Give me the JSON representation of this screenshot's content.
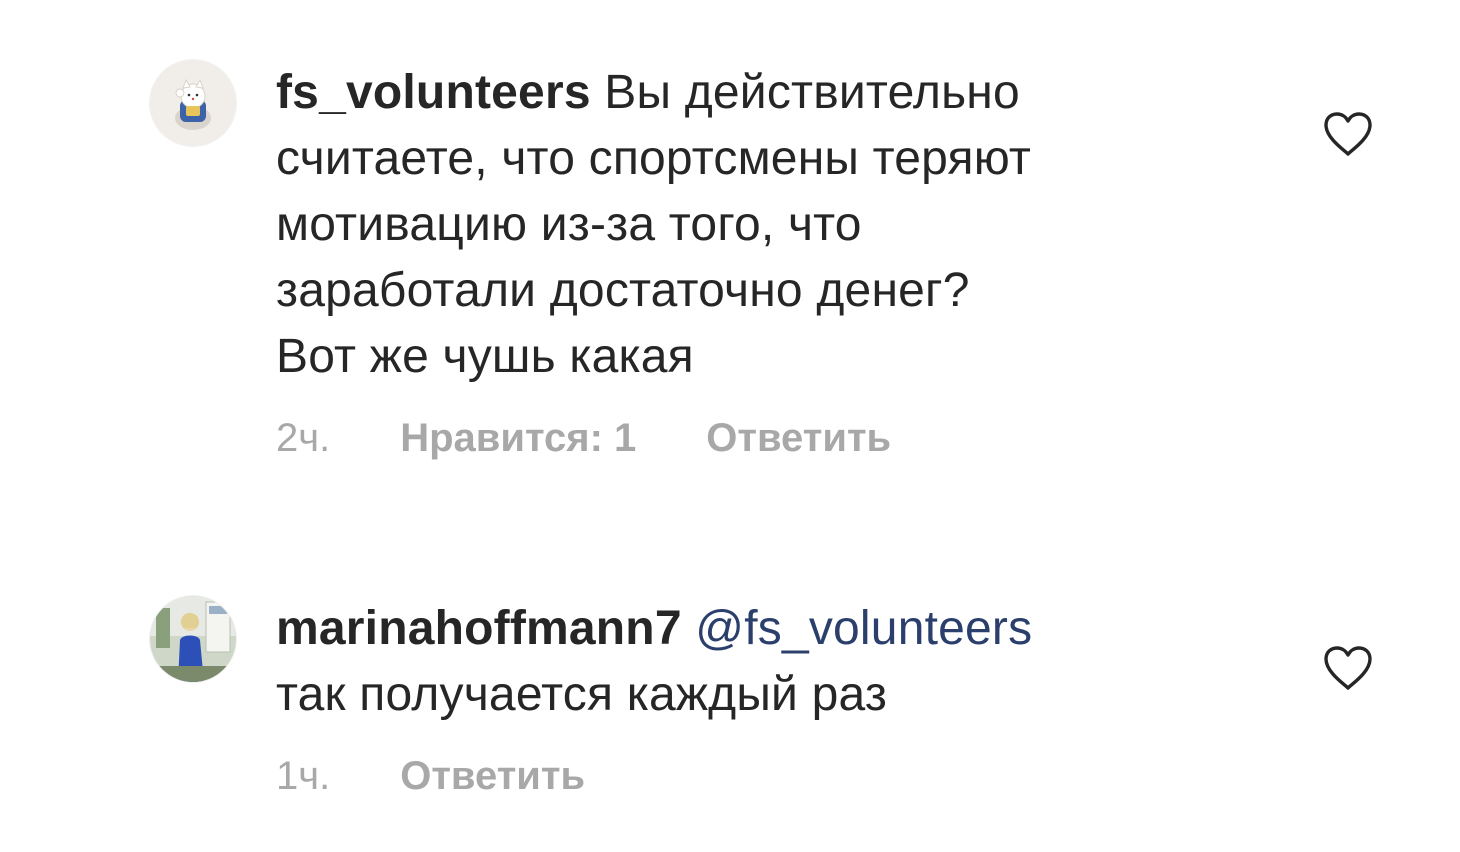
{
  "comments": [
    {
      "username": "fs_volunteers",
      "mention": "",
      "lines": [
        " Вы действительно",
        "считаете, что спортсмены теряют",
        "мотивацию из-за того, что",
        "заработали достаточно денег?",
        "Вот же чушь какая"
      ],
      "time": "2ч.",
      "likes": "Нравится: 1",
      "reply": "Ответить",
      "avatar_icon": "lucky-cat-avatar",
      "like_icon": "heart-outline-icon"
    },
    {
      "username": "marinahoffmann7",
      "mention": "@fs_volunteers",
      "lines": [
        "так получается каждый раз"
      ],
      "time": "1ч.",
      "likes": "",
      "reply": "Ответить",
      "avatar_icon": "person-photo-avatar",
      "like_icon": "heart-outline-icon"
    }
  ],
  "colors": {
    "text": "#262626",
    "muted": "#a8a8a8",
    "mention": "#2b3f6c",
    "heart_stroke": "#262626"
  }
}
